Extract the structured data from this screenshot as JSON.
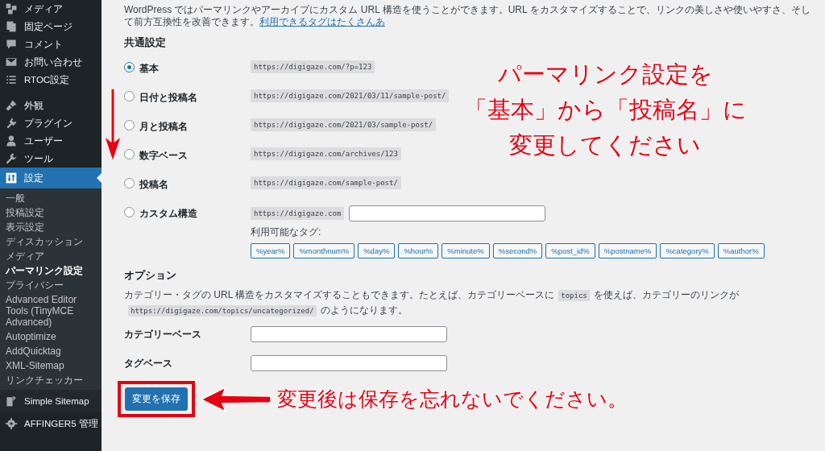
{
  "sidebar": {
    "menu_top": [
      {
        "label": "メディア",
        "selected": false
      },
      {
        "label": "固定ページ",
        "selected": false
      },
      {
        "label": "コメント",
        "selected": false
      },
      {
        "label": "お問い合わせ",
        "selected": false
      },
      {
        "label": "RTOC設定",
        "selected": false
      }
    ],
    "menu_mid": [
      {
        "label": "外観",
        "selected": false
      },
      {
        "label": "プラグイン",
        "selected": false
      },
      {
        "label": "ユーザー",
        "selected": false
      },
      {
        "label": "ツール",
        "selected": false
      },
      {
        "label": "設定",
        "selected": true
      }
    ],
    "submenu": [
      {
        "label": "一般",
        "selected": false
      },
      {
        "label": "投稿設定",
        "selected": false
      },
      {
        "label": "表示設定",
        "selected": false
      },
      {
        "label": "ディスカッション",
        "selected": false
      },
      {
        "label": "メディア",
        "selected": false
      },
      {
        "label": "パーマリンク設定",
        "selected": true
      },
      {
        "label": "プライバシー",
        "selected": false
      },
      {
        "label": "Advanced Editor Tools (TinyMCE Advanced)",
        "selected": false
      },
      {
        "label": "Autoptimize",
        "selected": false
      },
      {
        "label": "AddQuicktag",
        "selected": false
      },
      {
        "label": "XML-Sitemap",
        "selected": false
      },
      {
        "label": "リンクチェッカー",
        "selected": false
      }
    ],
    "menu_bottom": [
      {
        "label": "Simple Sitemap",
        "selected": false
      },
      {
        "label": "AFFINGER5 管理",
        "selected": false
      }
    ]
  },
  "intro": {
    "text": "WordPress ではパーマリンクやアーカイブにカスタム URL 構造を使うことができます。URL をカスタマイズすることで、リンクの美しさや使いやすさ、そして前方互換性を改善できます。",
    "link": "利用できるタグはたくさんあ"
  },
  "common_settings": {
    "heading": "共通設定",
    "options": [
      {
        "kind": "sample",
        "label": "基本",
        "sample": "https://digigaze.com/?p=123",
        "selected": true
      },
      {
        "kind": "sample",
        "label": "日付と投稿名",
        "sample": "https://digigaze.com/2021/03/11/sample-post/",
        "selected": false
      },
      {
        "kind": "sample",
        "label": "月と投稿名",
        "sample": "https://digigaze.com/2021/03/sample-post/",
        "selected": false
      },
      {
        "kind": "sample",
        "label": "数字ベース",
        "sample": "https://digigaze.com/archives/123",
        "selected": false
      },
      {
        "kind": "sample",
        "label": "投稿名",
        "sample": "https://digigaze.com/sample-post/",
        "selected": false
      },
      {
        "kind": "custom",
        "label": "カスタム構造",
        "sample": "https://digigaze.com",
        "selected": false
      }
    ],
    "tags_label": "利用可能なタグ:",
    "tags": [
      "%year%",
      "%monthnum%",
      "%day%",
      "%hour%",
      "%minute%",
      "%second%",
      "%post_id%",
      "%postname%",
      "%category%",
      "%author%"
    ]
  },
  "optional": {
    "heading": "オプション",
    "description": [
      {
        "kind": "text",
        "text": "カテゴリー・タグの URL 構造をカスタマイズすることもできます。たとえば、カテゴリーベースに"
      },
      {
        "kind": "code",
        "text": "topics"
      },
      {
        "kind": "text",
        "text": "を使えば、カテゴリーのリンクが"
      },
      {
        "kind": "code",
        "text": "https://digigaze.com/topics/uncategorized/"
      },
      {
        "kind": "text",
        "text": "のようになります。"
      }
    ],
    "fields": [
      {
        "label": "カテゴリーベース"
      },
      {
        "label": "タグベース"
      }
    ]
  },
  "save_button": "変更を保存",
  "annotations": {
    "callout": [
      "パーマリンク設定を",
      "「基本」から「投稿名」に",
      "変更してください"
    ],
    "save_note": "変更後は保存を忘れないでください。"
  }
}
